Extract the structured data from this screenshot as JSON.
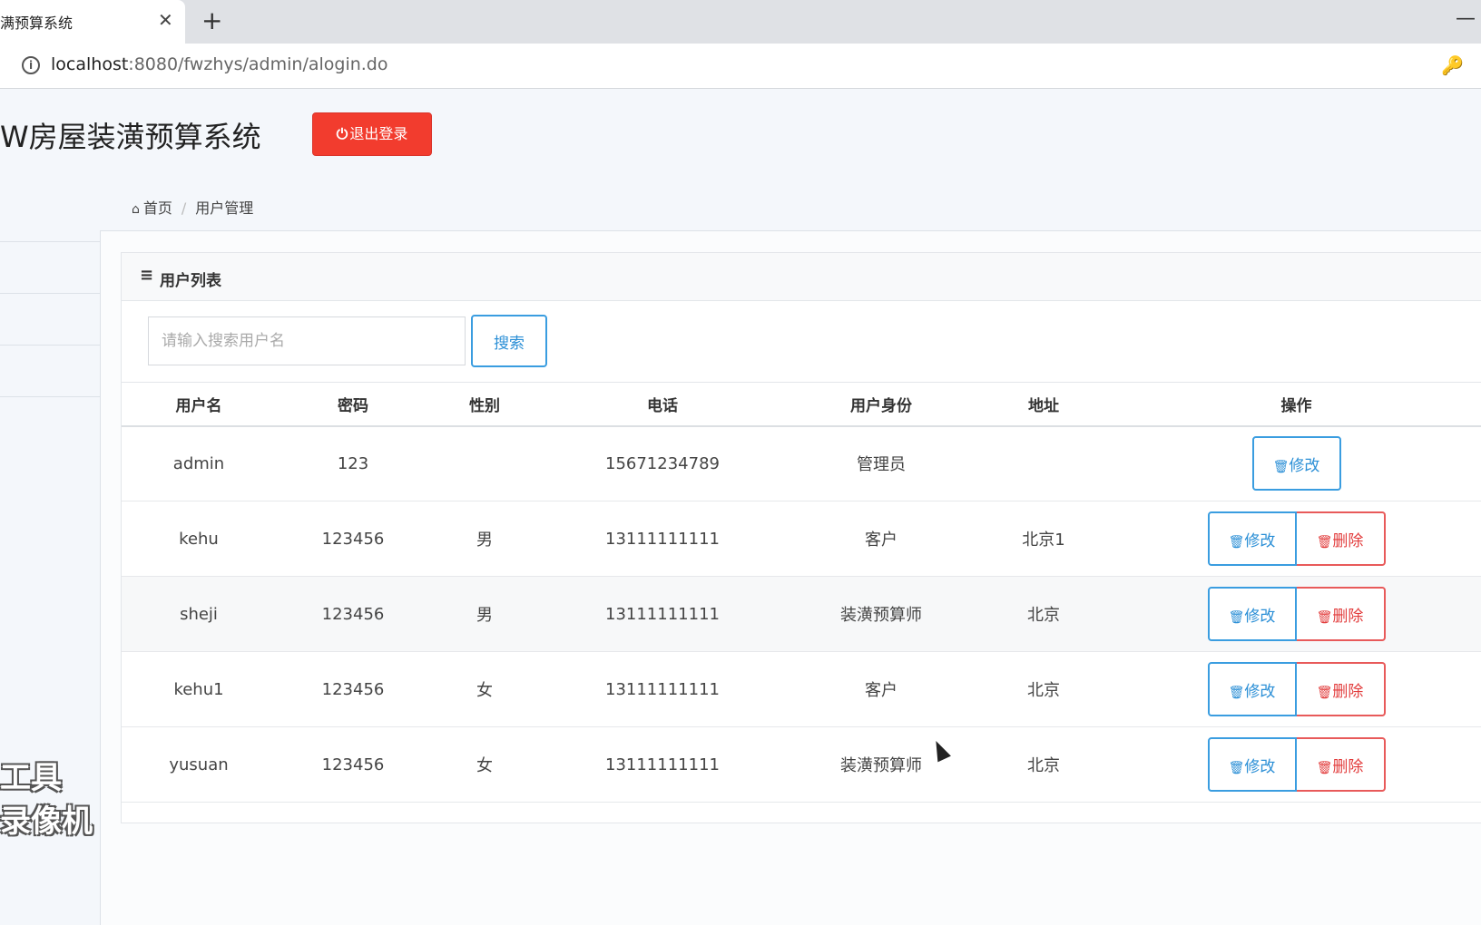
{
  "browser": {
    "tab_title": "满预算系统",
    "tab_close": "✕",
    "new_tab": "+",
    "window_min": "—",
    "url_host": "localhost",
    "url_rest": ":8080/fwzhys/admin/alogin.do",
    "info_icon": "i",
    "key_icon": "🔑"
  },
  "header": {
    "app_title": "W房屋装潢预算系统",
    "logout_icon": "⏻",
    "logout_label": "退出登录"
  },
  "breadcrumb": {
    "home_icon": "⌂",
    "home": "首页",
    "separator": "/",
    "current": "用户管理"
  },
  "card": {
    "list_icon": "≡",
    "title": "用户列表"
  },
  "search": {
    "placeholder": "请输入搜索用户名",
    "value": "",
    "button_label": "搜索"
  },
  "table": {
    "columns": [
      "用户名",
      "密码",
      "性别",
      "电话",
      "用户身份",
      "地址",
      "操作"
    ],
    "edit_icon": "🗑",
    "edit_label": "修改",
    "delete_icon": "🗑",
    "delete_label": "删除",
    "rows": [
      {
        "username": "admin",
        "password": "123",
        "gender": "",
        "phone": "15671234789",
        "role": "管理员",
        "address": ""
      },
      {
        "username": "kehu",
        "password": "123456",
        "gender": "男",
        "phone": "13111111111",
        "role": "客户",
        "address": "北京1"
      },
      {
        "username": "sheji",
        "password": "123456",
        "gender": "男",
        "phone": "13111111111",
        "role": "装潢预算师",
        "address": "北京"
      },
      {
        "username": "kehu1",
        "password": "123456",
        "gender": "女",
        "phone": "13111111111",
        "role": "客户",
        "address": "北京"
      },
      {
        "username": "yusuan",
        "password": "123456",
        "gender": "女",
        "phone": "13111111111",
        "role": "装潢预算师",
        "address": "北京"
      }
    ]
  },
  "watermark": {
    "line1": "工具",
    "line2": "录像机"
  }
}
